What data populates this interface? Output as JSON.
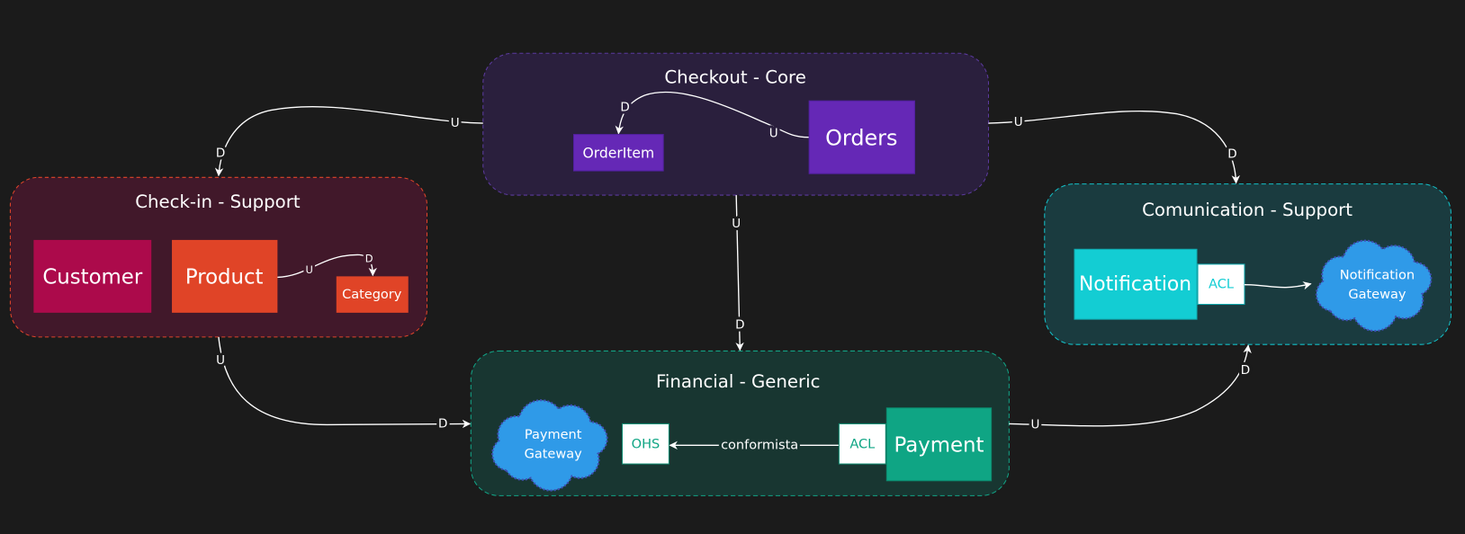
{
  "colors": {
    "background": "#1b1b1b",
    "core": "#6528b6",
    "support_checkin": "#e04427",
    "customer": "#ac0a4b",
    "communication": "#13cdd3",
    "financial": "#0fa584",
    "cloud": "#2f9ae8"
  },
  "contexts": {
    "checkout": {
      "title": "Checkout - Core",
      "entities": {
        "order_item": "OrderItem",
        "orders": "Orders"
      },
      "rel_upstream": "U",
      "rel_downstream": "D"
    },
    "checkin": {
      "title": "Check-in - Support",
      "entities": {
        "customer": "Customer",
        "product": "Product",
        "category": "Category"
      },
      "rel_upstream": "U",
      "rel_downstream": "D"
    },
    "communication": {
      "title": "Comunication - Support",
      "entities": {
        "notification": "Notification",
        "acl": "ACL",
        "gateway_line1": "Notification",
        "gateway_line2": "Gateway"
      }
    },
    "financial": {
      "title": "Financial - Generic",
      "entities": {
        "payment": "Payment",
        "acl": "ACL",
        "ohs": "OHS",
        "gateway_line1": "Payment",
        "gateway_line2": "Gateway"
      },
      "relation_label": "conformista"
    }
  },
  "edges": [
    {
      "from": "Checkout - Core",
      "to": "Check-in - Support",
      "upstream": "U",
      "downstream": "D"
    },
    {
      "from": "Checkout - Core",
      "to": "Comunication - Support",
      "upstream": "U",
      "downstream": "D"
    },
    {
      "from": "Checkout - Core",
      "to": "Financial - Generic",
      "upstream": "U",
      "downstream": "D"
    },
    {
      "from": "Check-in - Support",
      "to": "Financial - Generic",
      "upstream": "U",
      "downstream": "D"
    },
    {
      "from": "Financial - Generic",
      "to": "Comunication - Support",
      "upstream": "U",
      "downstream": "D"
    }
  ]
}
